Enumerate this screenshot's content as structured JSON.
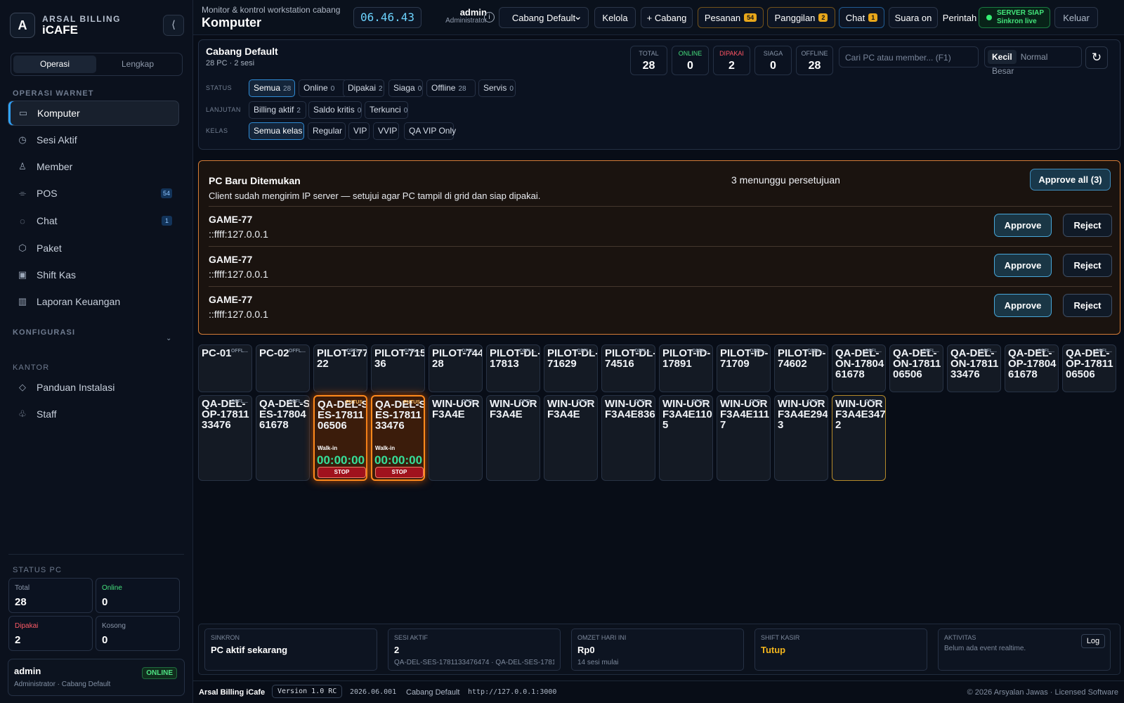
{
  "brand": {
    "logo": "A",
    "sub": "ARSAL BILLING",
    "main": "iCAFE",
    "collapse": "⟨"
  },
  "mode": [
    "Operasi",
    "Lengkap"
  ],
  "sections": {
    "operasi": "OPERASI WARNET",
    "konfig": "KONFIGURASI",
    "kantor": "KANTOR",
    "status": "STATUS PC"
  },
  "nav": [
    {
      "label": "Komputer",
      "icon": "monitor-icon",
      "glyph": "▭"
    },
    {
      "label": "Sesi Aktif",
      "icon": "clock-icon",
      "glyph": "◷"
    },
    {
      "label": "Member",
      "icon": "user-icon",
      "glyph": "♙"
    },
    {
      "label": "POS",
      "icon": "cart-icon",
      "glyph": "⌯",
      "badge": "54"
    },
    {
      "label": "Chat",
      "icon": "chat-icon",
      "glyph": "◌",
      "badge": "1"
    },
    {
      "label": "Paket",
      "icon": "box-icon",
      "glyph": "⬡"
    },
    {
      "label": "Shift Kas",
      "icon": "cash-icon",
      "glyph": "▣"
    },
    {
      "label": "Laporan Keuangan",
      "icon": "bar-chart-icon",
      "glyph": "▥"
    }
  ],
  "office_nav": [
    {
      "label": "Panduan Instalasi",
      "icon": "layers-icon",
      "glyph": "◇"
    },
    {
      "label": "Staff",
      "icon": "users-icon",
      "glyph": "♧"
    }
  ],
  "side_stats": [
    {
      "label": "Total",
      "value": "28",
      "color": "#8a96a9"
    },
    {
      "label": "Online",
      "value": "0",
      "color": "#45e17d"
    },
    {
      "label": "Dipakai",
      "value": "2",
      "color": "#ff5b67"
    },
    {
      "label": "Kosong",
      "value": "0",
      "color": "#8a96a9"
    }
  ],
  "user": {
    "name": "admin",
    "role": "Administrator · Cabang Default",
    "status": "ONLINE"
  },
  "header": {
    "small": "Monitor & kontrol workstation cabang",
    "title": "Komputer",
    "clock": "06.46.43",
    "admin": "admin",
    "role": "Administrator",
    "info": "i",
    "branch": "Cabang Default",
    "kelola": "Kelola",
    "add": "+ Cabang",
    "pesanan": "Pesanan",
    "pesanan_count": "54",
    "panggilan": "Panggilan",
    "panggilan_count": "2",
    "chat": "Chat",
    "chat_count": "1",
    "sound": "Suara on",
    "command": "Perintah",
    "server_title": "SERVER SIAP",
    "server_sub": "Sinkron live",
    "logout": "Keluar"
  },
  "branch": {
    "name": "Cabang Default",
    "summary": "28 PC · 2 sesi",
    "search": "Cari PC atau member... (F1)",
    "sizes": [
      "Kecil",
      "Normal",
      "Besar"
    ],
    "refresh": "↻"
  },
  "kpis": [
    {
      "label": "TOTAL",
      "value": "28",
      "color": "#8896aa"
    },
    {
      "label": "ONLINE",
      "value": "0",
      "color": "#46e07e"
    },
    {
      "label": "DIPAKAI",
      "value": "2",
      "color": "#ff5564"
    },
    {
      "label": "SIAGA",
      "value": "0",
      "color": "#8896aa"
    },
    {
      "label": "OFFLINE",
      "value": "28",
      "color": "#8896aa"
    }
  ],
  "filters": {
    "status_label": "STATUS",
    "lanjutan_label": "LANJUTAN",
    "kelas_label": "KELAS",
    "status": [
      [
        "Semua",
        "28"
      ],
      [
        "Online",
        "0"
      ],
      [
        "Dipakai",
        "2"
      ],
      [
        "Siaga",
        "0"
      ],
      [
        "Offline",
        "28"
      ],
      [
        "Servis",
        "0"
      ]
    ],
    "lanjutan": [
      [
        "Billing aktif",
        "2"
      ],
      [
        "Saldo kritis",
        "0"
      ],
      [
        "Terkunci",
        "0"
      ]
    ],
    "kelas": [
      "Semua kelas",
      "Regular",
      "VIP",
      "VVIP",
      "QA VIP Only"
    ]
  },
  "pending": {
    "title": "PC Baru Ditemukan",
    "desc": "Client sudah mengirim IP server — setujui agar PC tampil di grid dan siap dipakai.",
    "wait": "3 menunggu persetujuan",
    "approve_all": "Approve all (3)",
    "approve": "Approve",
    "reject": "Reject",
    "rows": [
      {
        "name": "GAME-77",
        "ip": "::ffff:127.0.0.1"
      },
      {
        "name": "GAME-77",
        "ip": "::ffff:127.0.0.1"
      },
      {
        "name": "GAME-77",
        "ip": "::ffff:127.0.0.1"
      }
    ]
  },
  "pcs": [
    {
      "name": "PC-01",
      "status": "OFFL..."
    },
    {
      "name": "PC-02",
      "status": "OFFL..."
    },
    {
      "name": "PILOT-17722",
      "status": "OFFL..."
    },
    {
      "name": "PILOT-71536",
      "status": "OFFL..."
    },
    {
      "name": "PILOT-74428",
      "status": "OFFL..."
    },
    {
      "name": "PILOT-DL-17813",
      "status": "OFFL..."
    },
    {
      "name": "PILOT-DL-71629",
      "status": "OFFL..."
    },
    {
      "name": "PILOT-DL-74516",
      "status": "OFFL..."
    },
    {
      "name": "PILOT-ID-17891",
      "status": "OFFL..."
    },
    {
      "name": "PILOT-ID-71709",
      "status": "OFFL..."
    },
    {
      "name": "PILOT-ID-74602",
      "status": "OFFL..."
    },
    {
      "name": "QA-DEL-ON-1780461678",
      "status": "OFFL..."
    },
    {
      "name": "QA-DEL-ON-1781106506",
      "status": "OFFL..."
    },
    {
      "name": "QA-DEL-ON-1781133476",
      "status": "OFFL..."
    },
    {
      "name": "QA-DEL-OP-1780461678",
      "status": "OFFL..."
    },
    {
      "name": "QA-DEL-OP-1781106506",
      "status": "OFFL..."
    },
    {
      "name": "QA-DEL-OP-1781133476",
      "status": "OFFL..."
    },
    {
      "name": "QA-DEL-SES-1780461678",
      "status": "OFFL..."
    },
    {
      "name": "QA-DEL-SES-1781106506",
      "status": "PUTUS",
      "walkin": "Walk-in",
      "timer": "00:00:00",
      "stop": "STOP",
      "active": true
    },
    {
      "name": "QA-DEL-SES-1781133476",
      "status": "PUTUS",
      "walkin": "Walk-in",
      "timer": "00:00:00",
      "stop": "STOP",
      "active": true
    },
    {
      "name": "WIN-UORF3A4E",
      "status": "OFFL..."
    },
    {
      "name": "WIN-UORF3A4E",
      "status": "OFFL..."
    },
    {
      "name": "WIN-UORF3A4E",
      "status": "OFFL..."
    },
    {
      "name": "WIN-UORF3A4E836",
      "status": "OFFL..."
    },
    {
      "name": "WIN-UORF3A4E1105",
      "status": "OFFL..."
    },
    {
      "name": "WIN-UORF3A4E1117",
      "status": "OFFL..."
    },
    {
      "name": "WIN-UORF3A4E2943",
      "status": "OFFL..."
    },
    {
      "name": "WIN-UORF3A4E3472",
      "status": "OFFL...",
      "gold": true
    }
  ],
  "bottom": [
    {
      "label": "SINKRON",
      "value": "PC aktif sekarang",
      "sub": ""
    },
    {
      "label": "SESI AKTIF",
      "value": "2",
      "sub": "QA-DEL-SES-1781133476474 · QA-DEL-SES-1781..."
    },
    {
      "label": "OMZET HARI INI",
      "value": "Rp0",
      "sub": "14 sesi mulai"
    },
    {
      "label": "SHIFT KASIR",
      "value": "Tutup",
      "sub": "",
      "color": "#f2b51d"
    },
    {
      "label": "AKTIVITAS",
      "value": "",
      "sub": "Belum ada event realtime.",
      "button": "Log"
    }
  ],
  "footer": {
    "app": "Arsal Billing iCafe",
    "version": "Version 1.0 RC",
    "build": "2026.06.001",
    "branch": "Cabang Default",
    "url": "http://127.0.0.1:3000",
    "copyright": "© 2026 Arsyalan Jawas · Licensed Software"
  }
}
